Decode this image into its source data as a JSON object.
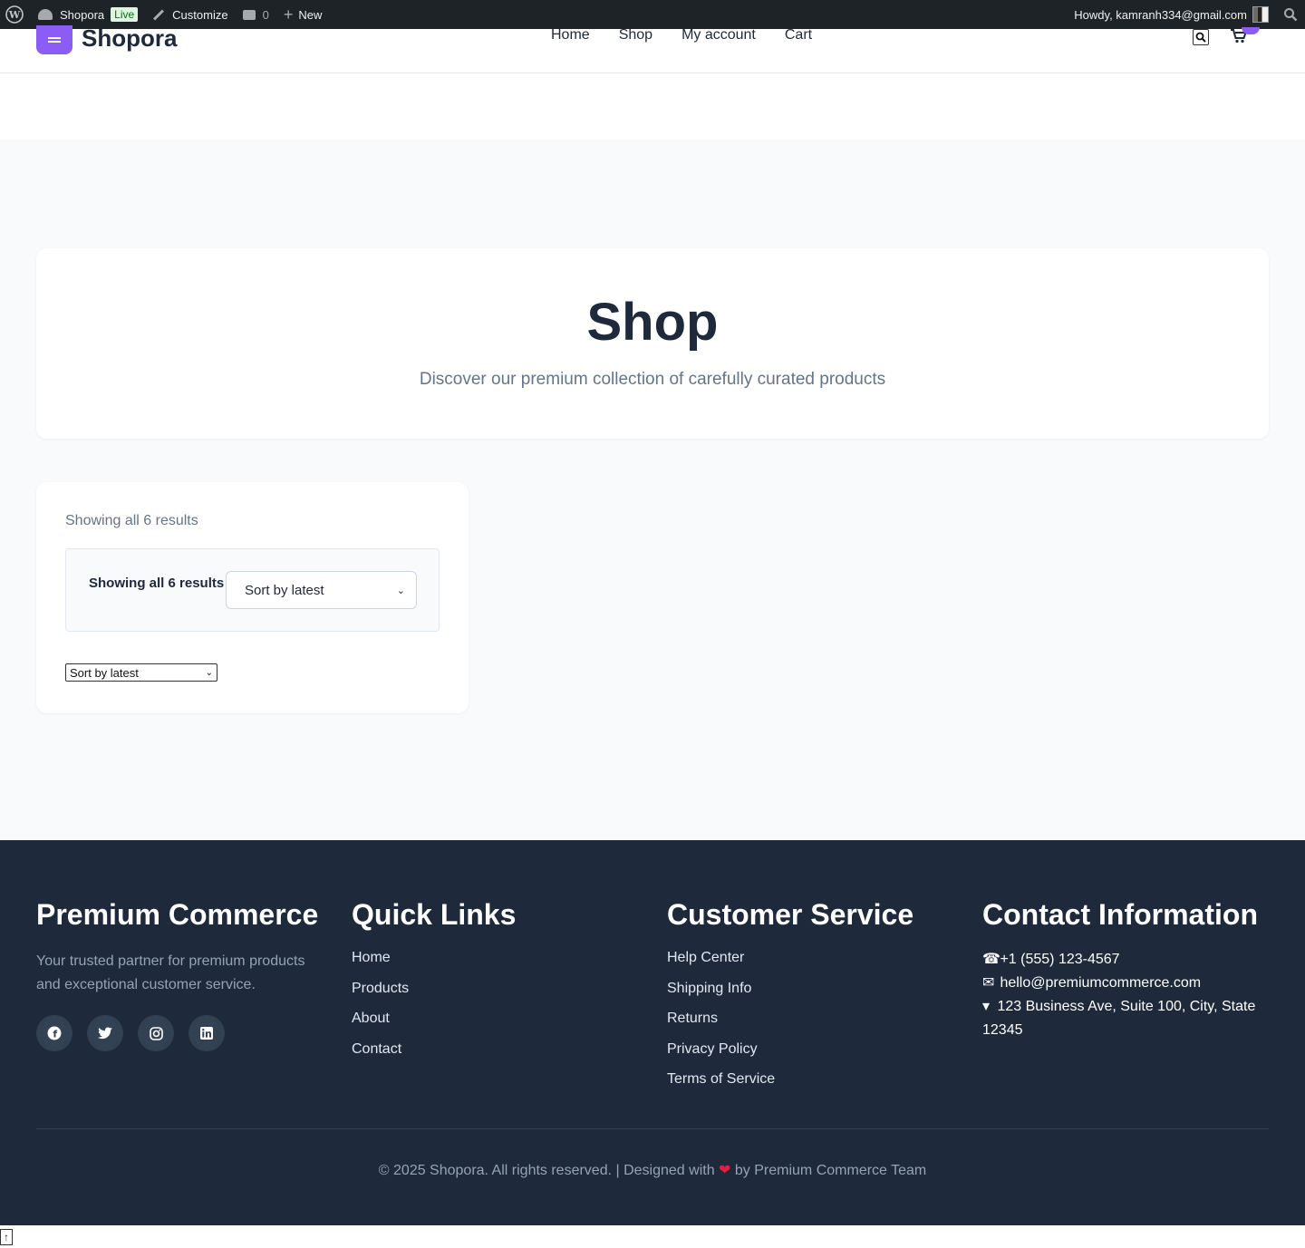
{
  "adminbar": {
    "site_name": "Shopora",
    "live_badge": "Live",
    "customize": "Customize",
    "comments_count": "0",
    "new_label": "New",
    "howdy": "Howdy, kamranh334@gmail.com"
  },
  "header": {
    "logo_text": "Shopora",
    "nav": [
      "Home",
      "Shop",
      "My account",
      "Cart"
    ]
  },
  "hero": {
    "title": "Shop",
    "subtitle": "Discover our premium collection of carefully curated products"
  },
  "shop": {
    "result_count": "Showing all 6 results",
    "inner_result_count": "Showing all 6 results",
    "sort_selected": "Sort by latest",
    "plain_sort_selected": "Sort by latest"
  },
  "footer": {
    "brand_title": "Premium Commerce",
    "brand_desc": "Your trusted partner for premium products and exceptional customer service.",
    "social": [
      "facebook-icon",
      "twitter-icon",
      "instagram-icon",
      "linkedin-icon"
    ],
    "quick_links_title": "Quick Links",
    "quick_links": [
      "Home",
      "Products",
      "About",
      "Contact"
    ],
    "customer_service_title": "Customer Service",
    "customer_service": [
      "Help Center",
      "Shipping Info",
      "Returns",
      "Privacy Policy",
      "Terms of Service"
    ],
    "contact_title": "Contact Information",
    "phone": "+1 (555) 123-4567",
    "email": "hello@premiumcommerce.com",
    "address": "123 Business Ave, Suite 100, City, State 12345",
    "copyright_prefix": "© 2025 Shopora. All rights reserved. | Designed with",
    "copyright_suffix": "by Premium Commerce Team"
  },
  "colors": {
    "accent": "#8b5cf6",
    "footer_bg": "#1e293b",
    "heart": "#e11d48"
  }
}
